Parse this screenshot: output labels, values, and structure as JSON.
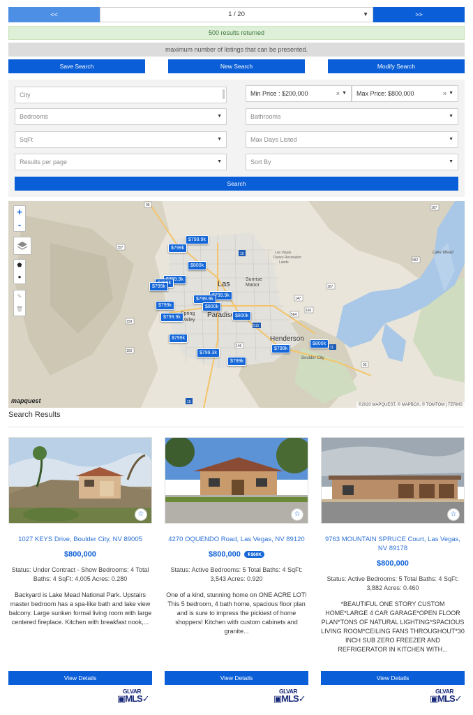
{
  "pagination": {
    "prev": "<<",
    "next": ">>",
    "page": "1 / 20"
  },
  "banners": {
    "results": "500 results returned",
    "limit": "maximum number of listings that can be presented."
  },
  "actions": {
    "save": "Save Search",
    "new": "New Search",
    "modify": "Modify Search"
  },
  "filters": {
    "city_placeholder": "City",
    "min_price": "Min Price : $200,000",
    "max_price": "Max Price: $800,000",
    "bedrooms": "Bedrooms",
    "bathrooms": "Bathrooms",
    "sqft": "SqFt",
    "max_days": "Max Days Listed",
    "results_per_page": "Results per page",
    "sort_by": "Sort By",
    "search": "Search"
  },
  "map": {
    "places": [
      "Las Vegas",
      "Paradise",
      "Henderson",
      "Sunrise Manor",
      "Spring Valley",
      "Boulder City",
      "Lake Mead",
      "Las Vegas Dunes Recreation Lands"
    ],
    "highway_shields": [
      "95",
      "157",
      "159",
      "160",
      "15",
      "215",
      "146",
      "147",
      "564",
      "166",
      "93",
      "167",
      "582",
      "515"
    ],
    "price_tags": [
      "$799k",
      "$799.9k",
      "$800k",
      "$799.9k",
      "$799k",
      "$799k",
      "$799.9k",
      "$799.9k",
      "$800k",
      "$799k",
      "$799.9k",
      "$800k",
      "$799k",
      "$799.3k",
      "$799k",
      "$799k",
      "$800k"
    ],
    "attribution": "©2020 MAPQUEST, © MAPBOX, © TOMTOM | TERMS",
    "logo": "mapquest",
    "controls": {
      "zoom_in": "+",
      "zoom_out": "-"
    }
  },
  "results": {
    "title": "Search Results",
    "cards": [
      {
        "address": "1027 KEYS Drive, Boulder City, NV 89005",
        "price": "$800,000",
        "badge": "",
        "status": "Status: Under Contract - Show Bedrooms: 4 Total Baths: 4 SqFt: 4,005 Acres: 0.280",
        "description": "Backyard is Lake Mead National Park. Upstairs master bedroom has a spa-like bath and lake view balcony. Large sunken formal living room with large centered fireplace. Kitchen with breakfast nook,...",
        "button": "View Details",
        "logo": "GLVAR MLS"
      },
      {
        "address": "4270 OQUENDO Road, Las Vegas, NV 89120",
        "price": "$800,000",
        "badge": "$60K",
        "status": "Status: Active Bedrooms: 5 Total Baths: 4 SqFt: 3,543 Acres: 0.920",
        "description": "One of a kind, stunning home on ONE ACRE LOT! This 5 bedroom, 4 bath home, spacious floor plan and is sure to impress the pickiest of home shoppers! Kitchen with custom cabinets and granite...",
        "button": "View Details",
        "logo": "GLVAR MLS"
      },
      {
        "address": "9763 MOUNTAIN SPRUCE Court, Las Vegas, NV 89178",
        "price": "$800,000",
        "badge": "",
        "status": "Status: Active Bedrooms: 5 Total Baths: 4 SqFt: 3,882 Acres: 0.460",
        "description": "*BEAUTIFUL ONE STORY CUSTOM HOME*LARGE 4 CAR GARAGE*OPEN FLOOR PLAN*TONS OF NATURAL LIGHTING*SPACIOUS LIVING ROOM*CEILING FANS THROUGHOUT*30 INCH SUB ZERO FREEZER AND REFRIGERATOR IN KITCHEN WITH...",
        "button": "View Details",
        "logo": "GLVAR MLS"
      }
    ]
  },
  "colors": {
    "primary": "#0a5ed7",
    "success_bg": "#dff0d8",
    "muted_bg": "#dcdcdc",
    "link": "#2a6fd6"
  }
}
